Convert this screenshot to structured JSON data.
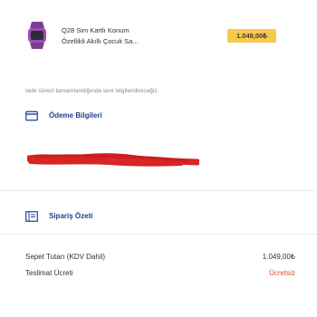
{
  "product": {
    "name": "Q28 Sim Kartlı Konum",
    "subtitle": "Özellikli Akıllı Çocuk Sa...",
    "price": "1.049,00₺",
    "thumb_icon": "smartwatch-icon"
  },
  "info_note": "İade süreci tamamlandığında seni bilgilendireceğiz.",
  "payment_section": {
    "title": "Ödeme Bilgileri",
    "icon": "credit-card-icon"
  },
  "summary_section": {
    "title": "Sipariş Özeti",
    "icon": "receipt-icon",
    "rows": [
      {
        "label": "Sepet Tutarı (KDV Dahil)",
        "value": "1.049,00₺"
      },
      {
        "label": "Teslimat Ücreti",
        "value": "Ücretsiz"
      }
    ]
  },
  "colors": {
    "accent": "#e04e2a",
    "price_badge": "#f7c84a",
    "section_title": "#1e3e8e",
    "redaction": "#d82424"
  }
}
